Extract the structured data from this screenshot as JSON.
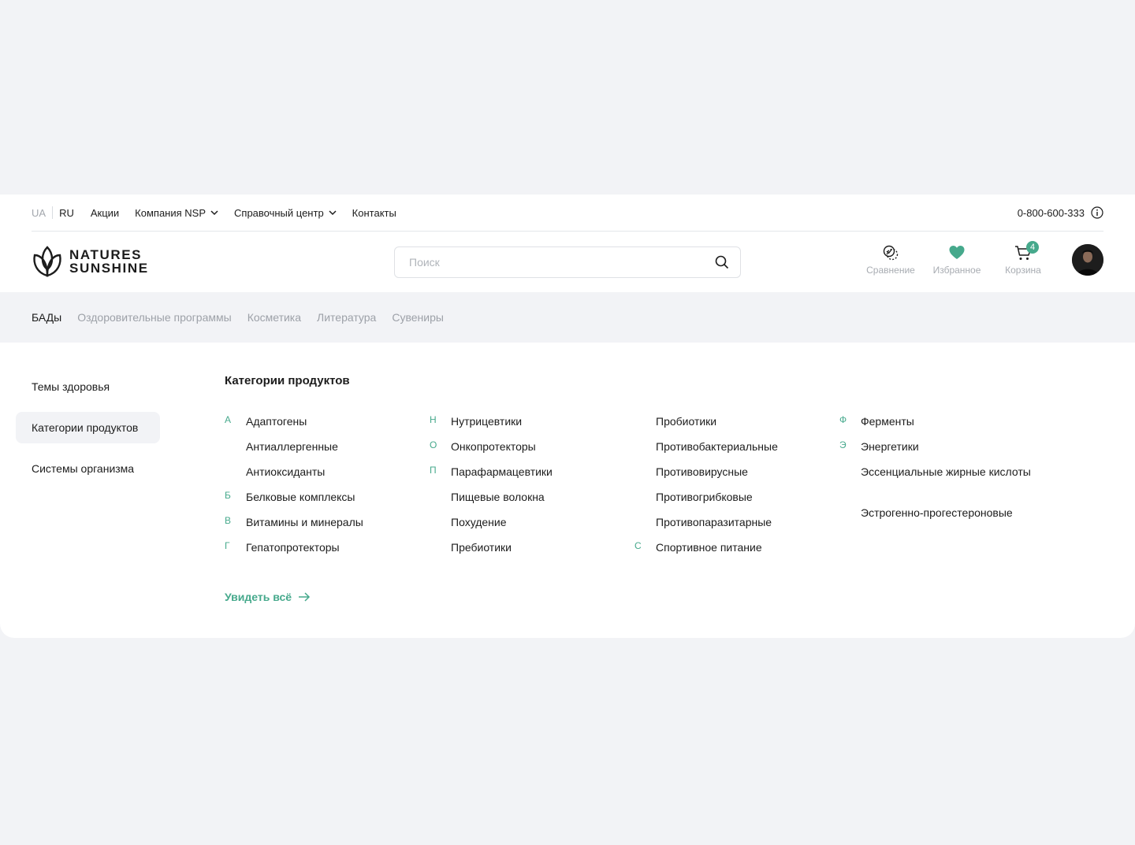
{
  "topbar": {
    "languages": [
      {
        "code": "UA",
        "active": false
      },
      {
        "code": "RU",
        "active": true
      }
    ],
    "links": [
      "Акции",
      "Компания NSP",
      "Справочный центр",
      "Контакты"
    ],
    "phone": "0-800-600-333"
  },
  "header": {
    "logo_line1": "NATURES",
    "logo_line2": "SUNSHINE",
    "search_placeholder": "Поиск",
    "actions": {
      "compare": "Сравнение",
      "favorites": "Избранное",
      "cart": "Корзина",
      "cart_count": "4"
    }
  },
  "catnav": {
    "tabs": [
      "БАДы",
      "Оздоровительные программы",
      "Косметика",
      "Литература",
      "Сувениры"
    ],
    "active": "БАДы"
  },
  "sidebar": {
    "items": [
      "Темы здоровья",
      "Категории продуктов",
      "Системы организма"
    ],
    "active": "Категории продуктов"
  },
  "content": {
    "title": "Категории продуктов",
    "columns": [
      [
        {
          "letter": "А",
          "name": "Адаптогены"
        },
        {
          "letter": "",
          "name": "Антиаллергенные"
        },
        {
          "letter": "",
          "name": "Антиоксиданты"
        },
        {
          "letter": "Б",
          "name": "Белковые комплексы"
        },
        {
          "letter": "В",
          "name": "Витамины и минералы"
        },
        {
          "letter": "Г",
          "name": "Гепатопротекторы"
        }
      ],
      [
        {
          "letter": "Н",
          "name": "Нутрицевтики"
        },
        {
          "letter": "О",
          "name": "Онкопротекторы"
        },
        {
          "letter": "П",
          "name": "Парафармацевтики"
        },
        {
          "letter": "",
          "name": "Пищевые волокна"
        },
        {
          "letter": "",
          "name": "Похудение"
        },
        {
          "letter": "",
          "name": "Пребиотики"
        }
      ],
      [
        {
          "letter": "",
          "name": "Пробиотики"
        },
        {
          "letter": "",
          "name": "Противобактериальные"
        },
        {
          "letter": "",
          "name": "Противовирусные"
        },
        {
          "letter": "",
          "name": "Противогрибковые"
        },
        {
          "letter": "",
          "name": "Противопаразитарные"
        },
        {
          "letter": "С",
          "name": "Спортивное питание"
        }
      ],
      [
        {
          "letter": "Ф",
          "name": "Ферменты"
        },
        {
          "letter": "Э",
          "name": "Энергетики"
        },
        {
          "letter": "",
          "name": "Эссенциальные жирные кислоты"
        },
        {
          "letter": "",
          "name": "Эстрогенно-прогестероновые"
        }
      ]
    ],
    "see_all": "Увидеть всё"
  },
  "colors": {
    "accent": "#46a98c",
    "background": "#f2f3f6",
    "muted_text": "#9da1a8"
  }
}
